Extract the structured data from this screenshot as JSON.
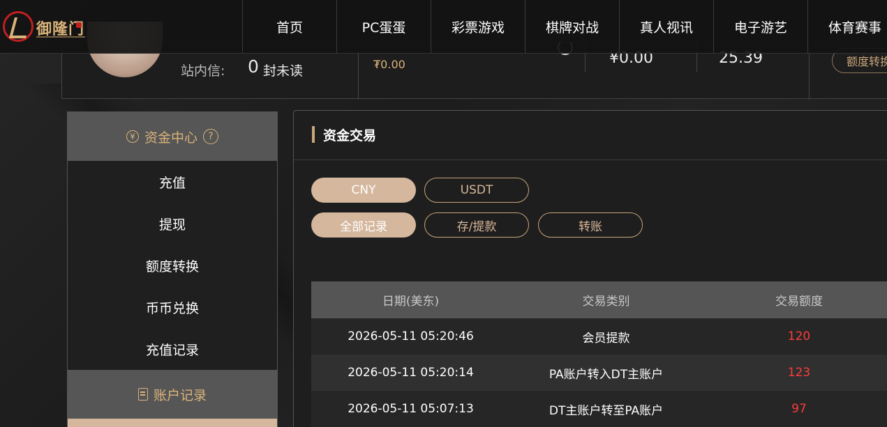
{
  "brand": {
    "name": "御隆门"
  },
  "nav": {
    "items": [
      "首页",
      "PC蛋蛋",
      "彩票游戏",
      "棋牌对战",
      "真人视讯",
      "电子游艺",
      "体育赛事"
    ]
  },
  "user": {
    "message_label": "站内信:",
    "message_count": "0",
    "message_unit": "封未读",
    "balance_small": "₮0.00",
    "balance_cny": "¥0.00",
    "balance_usdt": "25.39",
    "quota_button": "额度转换"
  },
  "sidebar": {
    "funds_header": "资金中心",
    "help": "?",
    "items": [
      "充值",
      "提现",
      "额度转换",
      "币币兑换",
      "充值记录"
    ],
    "account_header": "账户记录"
  },
  "panel": {
    "title": "资金交易",
    "currency_tabs": [
      "CNY",
      "USDT"
    ],
    "filter_tabs": [
      "全部记录",
      "存/提款",
      "转账"
    ]
  },
  "table": {
    "headers": [
      "日期(美东)",
      "交易类别",
      "交易额度"
    ],
    "rows": [
      {
        "date": "2026-05-11 05:20:46",
        "type": "会员提款",
        "amount": "120"
      },
      {
        "date": "2026-05-11 05:20:14",
        "type": "PA账户转入DT主账户",
        "amount": "123"
      },
      {
        "date": "2026-05-11 05:07:13",
        "type": "DT主账户转至PA账户",
        "amount": "97"
      }
    ]
  },
  "colors": {
    "accent": "#d4b79d",
    "gold": "#c9a57a",
    "amount_red": "#ff3b3b"
  }
}
